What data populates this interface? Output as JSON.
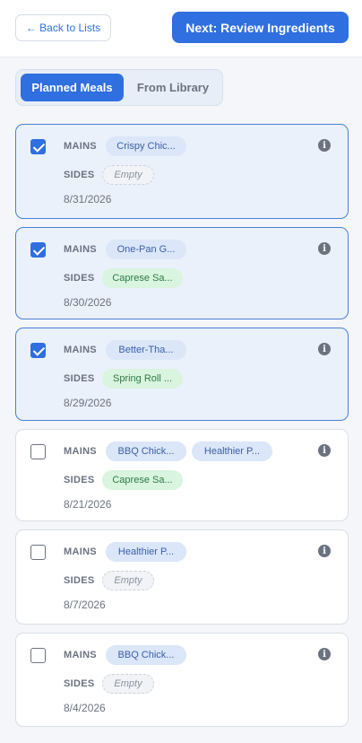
{
  "header": {
    "back_label": "← Back to Lists",
    "next_label": "Next: Review Ingredients"
  },
  "tabs": [
    {
      "label": "Planned Meals",
      "active": true
    },
    {
      "label": "From Library",
      "active": false
    }
  ],
  "labels": {
    "mains": "MAINS",
    "sides": "SIDES"
  },
  "meals": [
    {
      "checked": true,
      "mains": [
        "Crispy Chic..."
      ],
      "sides": [
        "Empty"
      ],
      "sides_empty": true,
      "date": "8/31/2026"
    },
    {
      "checked": true,
      "mains": [
        "One-Pan G..."
      ],
      "sides": [
        "Caprese Sa..."
      ],
      "sides_empty": false,
      "date": "8/30/2026"
    },
    {
      "checked": true,
      "mains": [
        "Better-Tha..."
      ],
      "sides": [
        "Spring Roll ..."
      ],
      "sides_empty": false,
      "date": "8/29/2026"
    },
    {
      "checked": false,
      "mains": [
        "BBQ Chick...",
        "Healthier P..."
      ],
      "sides": [
        "Caprese Sa..."
      ],
      "sides_empty": false,
      "date": "8/21/2026"
    },
    {
      "checked": false,
      "mains": [
        "Healthier P..."
      ],
      "sides": [
        "Empty"
      ],
      "sides_empty": true,
      "date": "8/7/2026"
    },
    {
      "checked": false,
      "mains": [
        "BBQ Chick..."
      ],
      "sides": [
        "Empty"
      ],
      "sides_empty": true,
      "date": "8/4/2026"
    }
  ],
  "colors": {
    "accent": "#2f6fe0",
    "selected_bg": "#eaf1fb"
  },
  "icons": {
    "info": "info-icon",
    "check": "checkbox"
  }
}
